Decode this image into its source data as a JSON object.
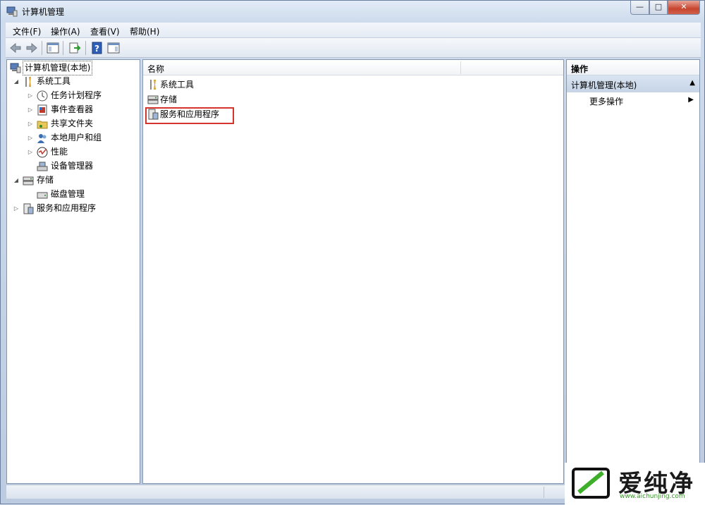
{
  "window": {
    "title": "计算机管理",
    "min": "—",
    "max": "□",
    "close": "✕"
  },
  "menu": [
    "文件(F)",
    "操作(A)",
    "查看(V)",
    "帮助(H)"
  ],
  "tree": {
    "root": "计算机管理(本地)",
    "system_tools": "系统工具",
    "task_scheduler": "任务计划程序",
    "event_viewer": "事件查看器",
    "shared_folders": "共享文件夹",
    "local_users": "本地用户和组",
    "performance": "性能",
    "device_manager": "设备管理器",
    "storage": "存储",
    "disk_management": "磁盘管理",
    "services_apps": "服务和应用程序"
  },
  "list": {
    "column_name": "名称",
    "items": [
      "系统工具",
      "存储",
      "服务和应用程序"
    ]
  },
  "actions": {
    "header": "操作",
    "group": "计算机管理(本地)",
    "more": "更多操作"
  },
  "watermark": {
    "text": "爱纯净",
    "url": "www.aichunjing.com"
  }
}
